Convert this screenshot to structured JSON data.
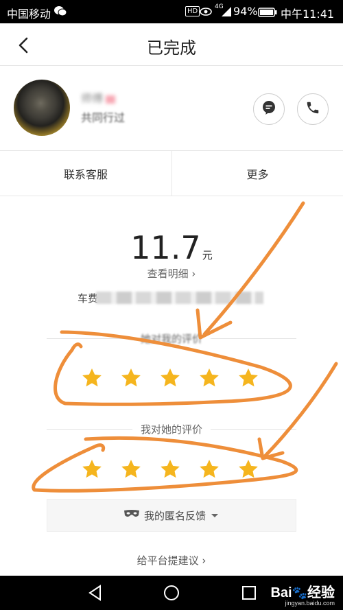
{
  "status_bar": {
    "carrier": "中国移动",
    "network": "4G",
    "battery": "94%",
    "time": "中午11:41"
  },
  "header": {
    "title": "已完成"
  },
  "driver": {
    "name_hint": "师傅",
    "subtitle": "共同行过"
  },
  "actions": {
    "customer_service": "联系客服",
    "more": "更多"
  },
  "fare": {
    "amount": "11.7",
    "unit": "元",
    "detail_link": "查看明细 ›",
    "fee_prefix": "车费"
  },
  "ratings": {
    "their_rating_label": "她对我的评价",
    "their_stars": 5,
    "my_rating_label": "我对她的评价",
    "my_stars": 5
  },
  "feedback": {
    "label": "我的匿名反馈"
  },
  "suggest": {
    "label": "给平台提建议 ›"
  },
  "watermark": {
    "brand": "Bai",
    "brand_cn": "经验",
    "site": "jingyan.baidu.com"
  },
  "colors": {
    "star": "#F5B51E",
    "annotation": "#EE8E3A"
  }
}
